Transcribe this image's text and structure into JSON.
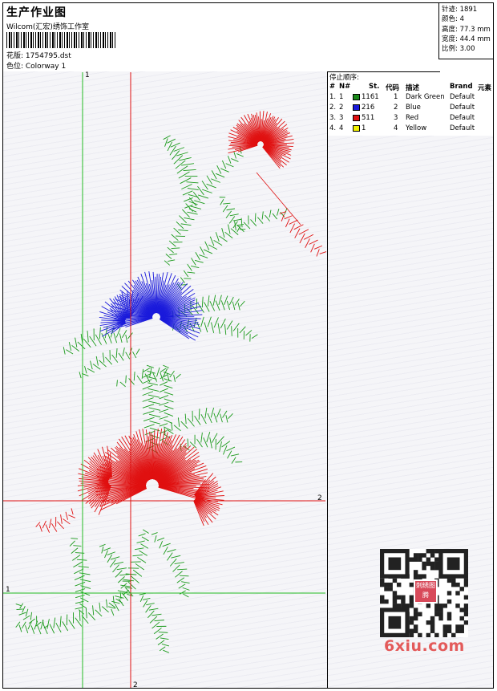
{
  "header": {
    "title": "生产作业图",
    "company": "Wilcom(汇宏)绣饰工作室",
    "design_label": "花版: 1754795.dst",
    "colorway_label": "色位: Colorway 1"
  },
  "stats": {
    "stitches": "针迹: 1891",
    "colors": "颜色: 4",
    "height": "高度: 77.3 mm",
    "width": "宽度: 44.4 mm",
    "scale": "比例: 3.00"
  },
  "stop_sequence": {
    "caption": "停止顺序:",
    "columns": [
      "#",
      "N#",
      "St.",
      "代码",
      "描述",
      "Brand",
      "元素"
    ],
    "rows": [
      {
        "index": "1.",
        "n": "1",
        "color": "#1a8a1a",
        "stitches": "1161",
        "code": "1",
        "desc": "Dark Green",
        "brand": "Default"
      },
      {
        "index": "2.",
        "n": "2",
        "color": "#1a1adb",
        "stitches": "216",
        "code": "2",
        "desc": "Blue",
        "brand": "Default"
      },
      {
        "index": "3.",
        "n": "3",
        "color": "#e01010",
        "stitches": "511",
        "code": "3",
        "desc": "Red",
        "brand": "Default"
      },
      {
        "index": "4.",
        "n": "4",
        "color": "#f0f000",
        "stitches": "1",
        "code": "4",
        "desc": "Yellow",
        "brand": "Default"
      }
    ]
  },
  "guides": {
    "v1": "1",
    "h2": "2",
    "h1": "1",
    "v2": "2"
  },
  "watermark": {
    "brand": "6xiu.com",
    "seal": "刺绣图腾"
  },
  "colors": {
    "green": "#1a9a1a",
    "blue": "#1a1adb",
    "red": "#e01010",
    "guide_green": "#22bb22",
    "guide_red": "#e01010"
  }
}
